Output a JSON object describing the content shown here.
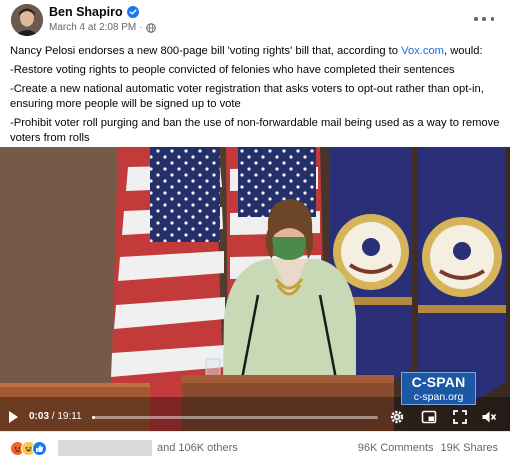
{
  "post": {
    "author": "Ben Shapiro",
    "timestamp": "March 4 at 2:08 PM",
    "separator": "·",
    "text": {
      "intro_before": "Nancy Pelosi endorses a new 800-page bill 'voting rights' bill that, according to ",
      "intro_link": "Vox.com",
      "intro_after": ", would:",
      "items": [
        "-Restore voting rights to people convicted of felonies who have completed their sentences",
        "-Create a new national automatic voter registration that asks voters to opt-out rather than opt-in, ensuring more people will be signed up to vote",
        "-Prohibit voter roll purging and ban the use of non-forwardable mail being used as a way to remove voters from rolls"
      ]
    }
  },
  "video": {
    "watermark_title": "C-SPAN",
    "watermark_url": "c-span.org",
    "current_time": "0:03",
    "duration_sep": " / ",
    "duration": "19:11",
    "progress": 0.003
  },
  "engagement": {
    "reactions": [
      "angry",
      "haha",
      "like"
    ],
    "others": "and 106K others",
    "comments": "96K Comments",
    "shares": "19K Shares"
  },
  "colors": {
    "link": "#216fdb",
    "secondary_text": "#65676b",
    "cspan_blue": "#1d58a6",
    "verified_blue": "#1877f2"
  }
}
